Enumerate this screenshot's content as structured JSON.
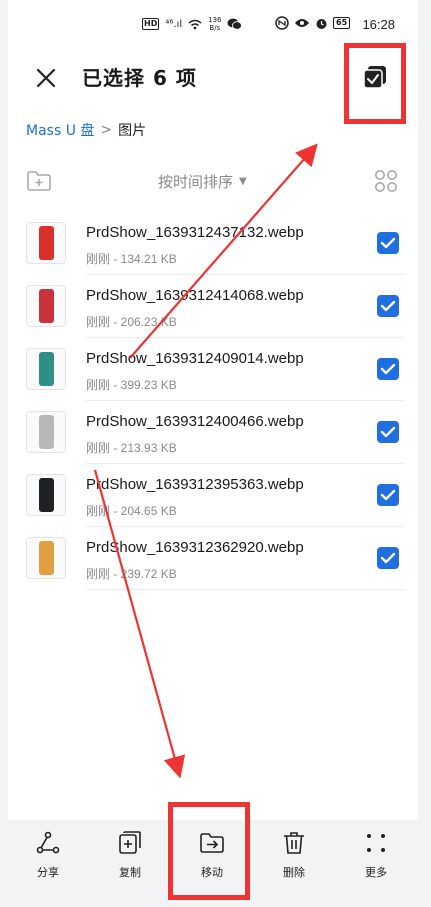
{
  "status_bar": {
    "hd_badge": "HD",
    "signal": "⁴⁶.ıl",
    "net_speed_value": "136",
    "net_speed_unit": "B/s",
    "battery": "65",
    "time": "16:28"
  },
  "header": {
    "title": "已选择 6 项"
  },
  "breadcrumb": {
    "root": "Mass U 盘",
    "separator": ">",
    "current": "图片"
  },
  "toolbar": {
    "sort_label": "按时间排序",
    "sort_caret": "▼"
  },
  "files": [
    {
      "name": "PrdShow_1639312437132.webp",
      "meta": "刚刚 - 134.21 KB",
      "checked": true,
      "thumb_color": "#d9302c"
    },
    {
      "name": "PrdShow_1639312414068.webp",
      "meta": "刚刚 - 206.23 KB",
      "checked": true,
      "thumb_color": "#c8323a"
    },
    {
      "name": "PrdShow_1639312409014.webp",
      "meta": "刚刚 - 399.23 KB",
      "checked": true,
      "thumb_color": "#2f8f86"
    },
    {
      "name": "PrdShow_1639312400466.webp",
      "meta": "刚刚 - 213.93 KB",
      "checked": true,
      "thumb_color": "#b8b8b8"
    },
    {
      "name": "PrdShow_1639312395363.webp",
      "meta": "刚刚 - 204.65 KB",
      "checked": true,
      "thumb_color": "#1e2226"
    },
    {
      "name": "PrdShow_1639312362920.webp",
      "meta": "刚刚 - 239.72 KB",
      "checked": true,
      "thumb_color": "#e0a040"
    }
  ],
  "bottom_actions": [
    {
      "label": "分享",
      "icon": "share-icon"
    },
    {
      "label": "复制",
      "icon": "copy-icon"
    },
    {
      "label": "移动",
      "icon": "move-icon"
    },
    {
      "label": "删除",
      "icon": "delete-icon"
    },
    {
      "label": "更多",
      "icon": "more-icon"
    }
  ],
  "colors": {
    "accent": "#1f6fe0",
    "annotation": "#ee3333",
    "link": "#1a6fd8"
  }
}
